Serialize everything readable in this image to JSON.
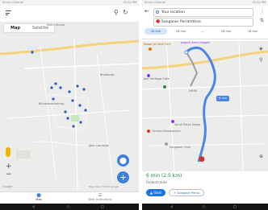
{
  "left": {
    "status_left": "Shusil Chakrak",
    "status_right": "03:04 PM",
    "map_tab": "Map",
    "satellite_tab": "Satellite",
    "bottom_nav": [
      {
        "label": "Map"
      },
      {
        "label": "Near Institutions"
      }
    ],
    "map_labels": {
      "top": "Jaipur Kinnal",
      "left": "Bhinatarachemisy",
      "right": "Bhadarwa",
      "bottom": "Jobo Caurniyal"
    },
    "attribution": "Map data ©2023 Google"
  },
  "right": {
    "status_left": "Shusil Chakrak",
    "status_right": "03:04 PM",
    "origin": "Your location",
    "destination": "Sanganer Periamttine",
    "modes": [
      "18 min",
      "18 min",
      "—",
      "18 min",
      "18 min"
    ],
    "route_badge": "6 min",
    "places": {
      "p1": "Sawai Jai Garh Fort",
      "p2": "Jaigarh Arms Kappes",
      "p3": "Jain Heritage Cafe",
      "p4": "Sandi Vidya Vishar",
      "p5": "Tirahan Ramashetra",
      "p6": "Sanganer Ojiel",
      "road_a": "NH48",
      "road_b": "4 mins"
    },
    "summary_time": "6 min (2.5 km)",
    "summary_sub": "Fastest route",
    "start_button": "Start",
    "share_button": "Sanganer Pema",
    "icons": [
      "back-arrow-icon",
      "swap-icon",
      "more-icon",
      "layers-icon",
      "search-icon",
      "compass-icon",
      "share-icon",
      "navigation-icon"
    ],
    "route_color": "#4a86e8"
  }
}
